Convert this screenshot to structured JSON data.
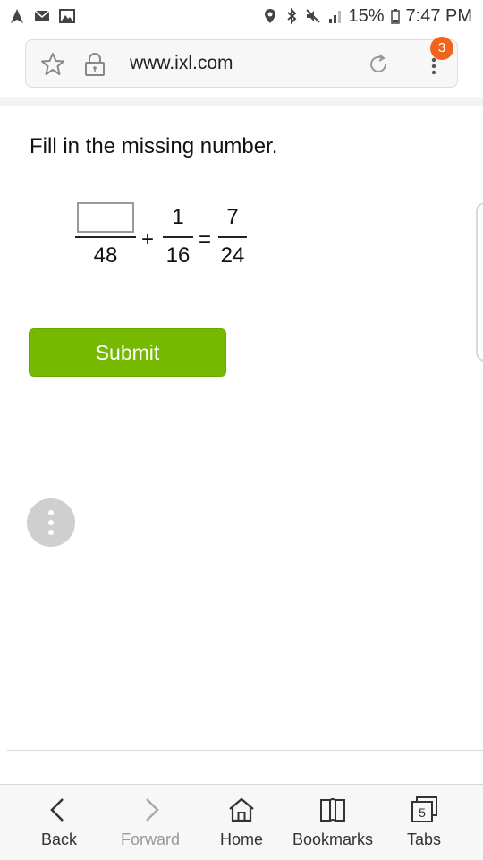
{
  "status_bar": {
    "left_icons": [
      "navigation-arrow-icon",
      "mail-icon",
      "image-icon"
    ],
    "right_icons": [
      "location-icon",
      "bluetooth-icon",
      "mute-icon",
      "lte-signal-icon",
      "battery-icon"
    ],
    "battery_percent": "15%",
    "time": "7:47 PM"
  },
  "browser": {
    "url": "www.ixl.com",
    "tab_badge_count": "3"
  },
  "question": {
    "prompt": "Fill in the missing number.",
    "fraction1": {
      "numerator": "",
      "denominator": "48"
    },
    "operator": "+",
    "fraction2": {
      "numerator": "1",
      "denominator": "16"
    },
    "equals": "=",
    "fraction3": {
      "numerator": "7",
      "denominator": "24"
    }
  },
  "submit_label": "Submit",
  "bottom_nav": {
    "back": "Back",
    "forward": "Forward",
    "home": "Home",
    "bookmarks": "Bookmarks",
    "tabs": "Tabs",
    "tabs_count": "5"
  },
  "colors": {
    "submit_green": "#76b900",
    "badge_orange": "#f0641e"
  }
}
